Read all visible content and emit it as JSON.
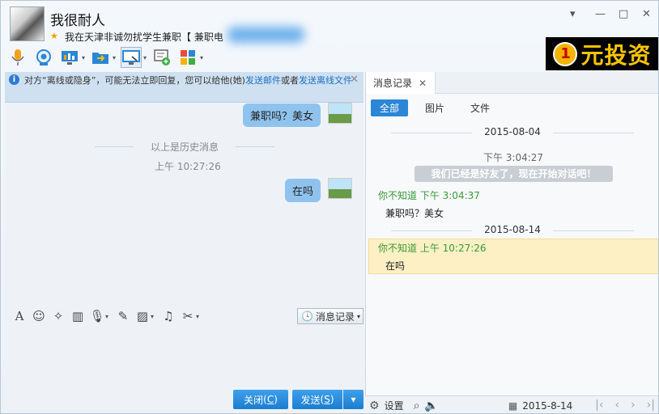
{
  "header": {
    "title": "我很耐人",
    "signature": "我在天津非诚勿扰学生兼职【 兼职电"
  },
  "ad": {
    "number": "1",
    "text": "元投资"
  },
  "notice": {
    "prefix": "对方“离线或隐身”，可能无法立即回复，您可以给他(她)",
    "link1": "发送邮件",
    "middle": "或者",
    "link2": "发送离线文件"
  },
  "chat": {
    "msg1": "兼职吗？美女",
    "history_label": "以上是历史消息",
    "time": "上午 10:27:26",
    "msg2": "在吗"
  },
  "inputbar": {
    "history_button": "消息记录"
  },
  "buttons": {
    "close": "关闭",
    "close_key": "C",
    "send": "发送",
    "send_key": "S"
  },
  "record": {
    "tab": "消息记录",
    "filters": [
      "全部",
      "图片",
      "文件"
    ],
    "date1": "2015-08-04",
    "systime": "下午 3:04:27",
    "sysmsg": "我们已经是好友了，现在开始对话吧！",
    "sender1": "你不知道 下午 3:04:37",
    "text1": "兼职吗？美女",
    "date2": "2015-08-14",
    "sender2": "你不知道 上午 10:27:26",
    "text2": "在吗"
  },
  "bottom": {
    "settings": "设置",
    "date": "2015-8-14"
  }
}
